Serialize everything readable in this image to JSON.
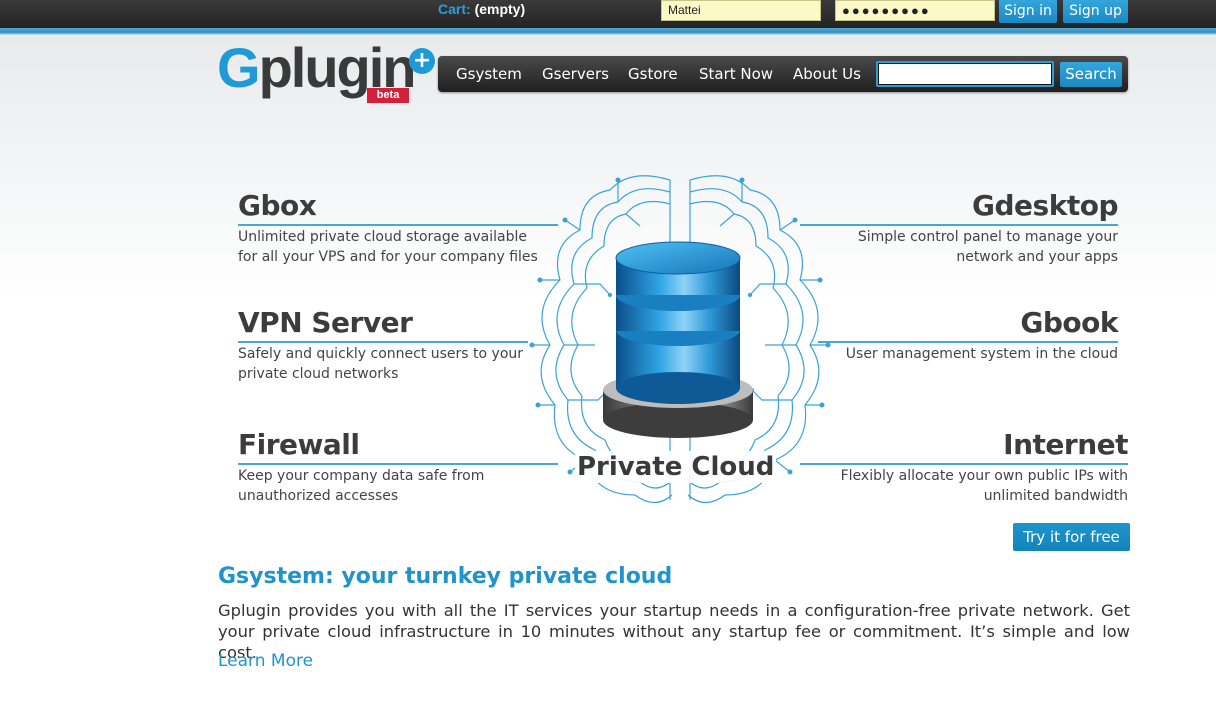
{
  "topbar": {
    "cart_label": "Cart:",
    "cart_value": "(empty)",
    "username_value": "Mattei",
    "password_mask": "●●●●●●●●●",
    "signin_label": "Sign in",
    "signup_label": "Sign up"
  },
  "logo": {
    "g": "G",
    "rest": "plugin",
    "plus": "+",
    "beta": "beta"
  },
  "nav": {
    "items": [
      "Gsystem",
      "Gservers",
      "Gstore",
      "Start Now",
      "About Us"
    ],
    "search_value": "",
    "search_label": "Search"
  },
  "features": {
    "gbox": {
      "title": "Gbox",
      "desc": "Unlimited private cloud storage available for all your VPS and for your company files"
    },
    "vpn": {
      "title": "VPN Server",
      "desc": "Safely and quickly connect users to your private cloud networks"
    },
    "firewall": {
      "title": "Firewall",
      "desc": "Keep your company data safe from unauthorized accesses"
    },
    "gdesktop": {
      "title": "Gdesktop",
      "desc": "Simple control panel to manage your network and your apps"
    },
    "gbook": {
      "title": "Gbook",
      "desc": "User management system in the cloud"
    },
    "internet": {
      "title": "Internet",
      "desc": "Flexibly allocate your own public IPs with unlimited bandwidth"
    }
  },
  "hero": {
    "label": "Private Cloud",
    "try_label": "Try it for free"
  },
  "section": {
    "title": "Gsystem: your turnkey private cloud",
    "body": "Gplugin provides you with all the IT services your startup needs in a configuration-free private network. Get your private cloud infrastructure in 10 minutes without any startup fee or commitment. It’s simple and low cost.",
    "learn_more": "Learn More"
  },
  "colors": {
    "accent": "#1f9ad6",
    "topbar": "#2b2b2b",
    "input_bg": "#fbf9c7",
    "beta": "#d4203a"
  }
}
